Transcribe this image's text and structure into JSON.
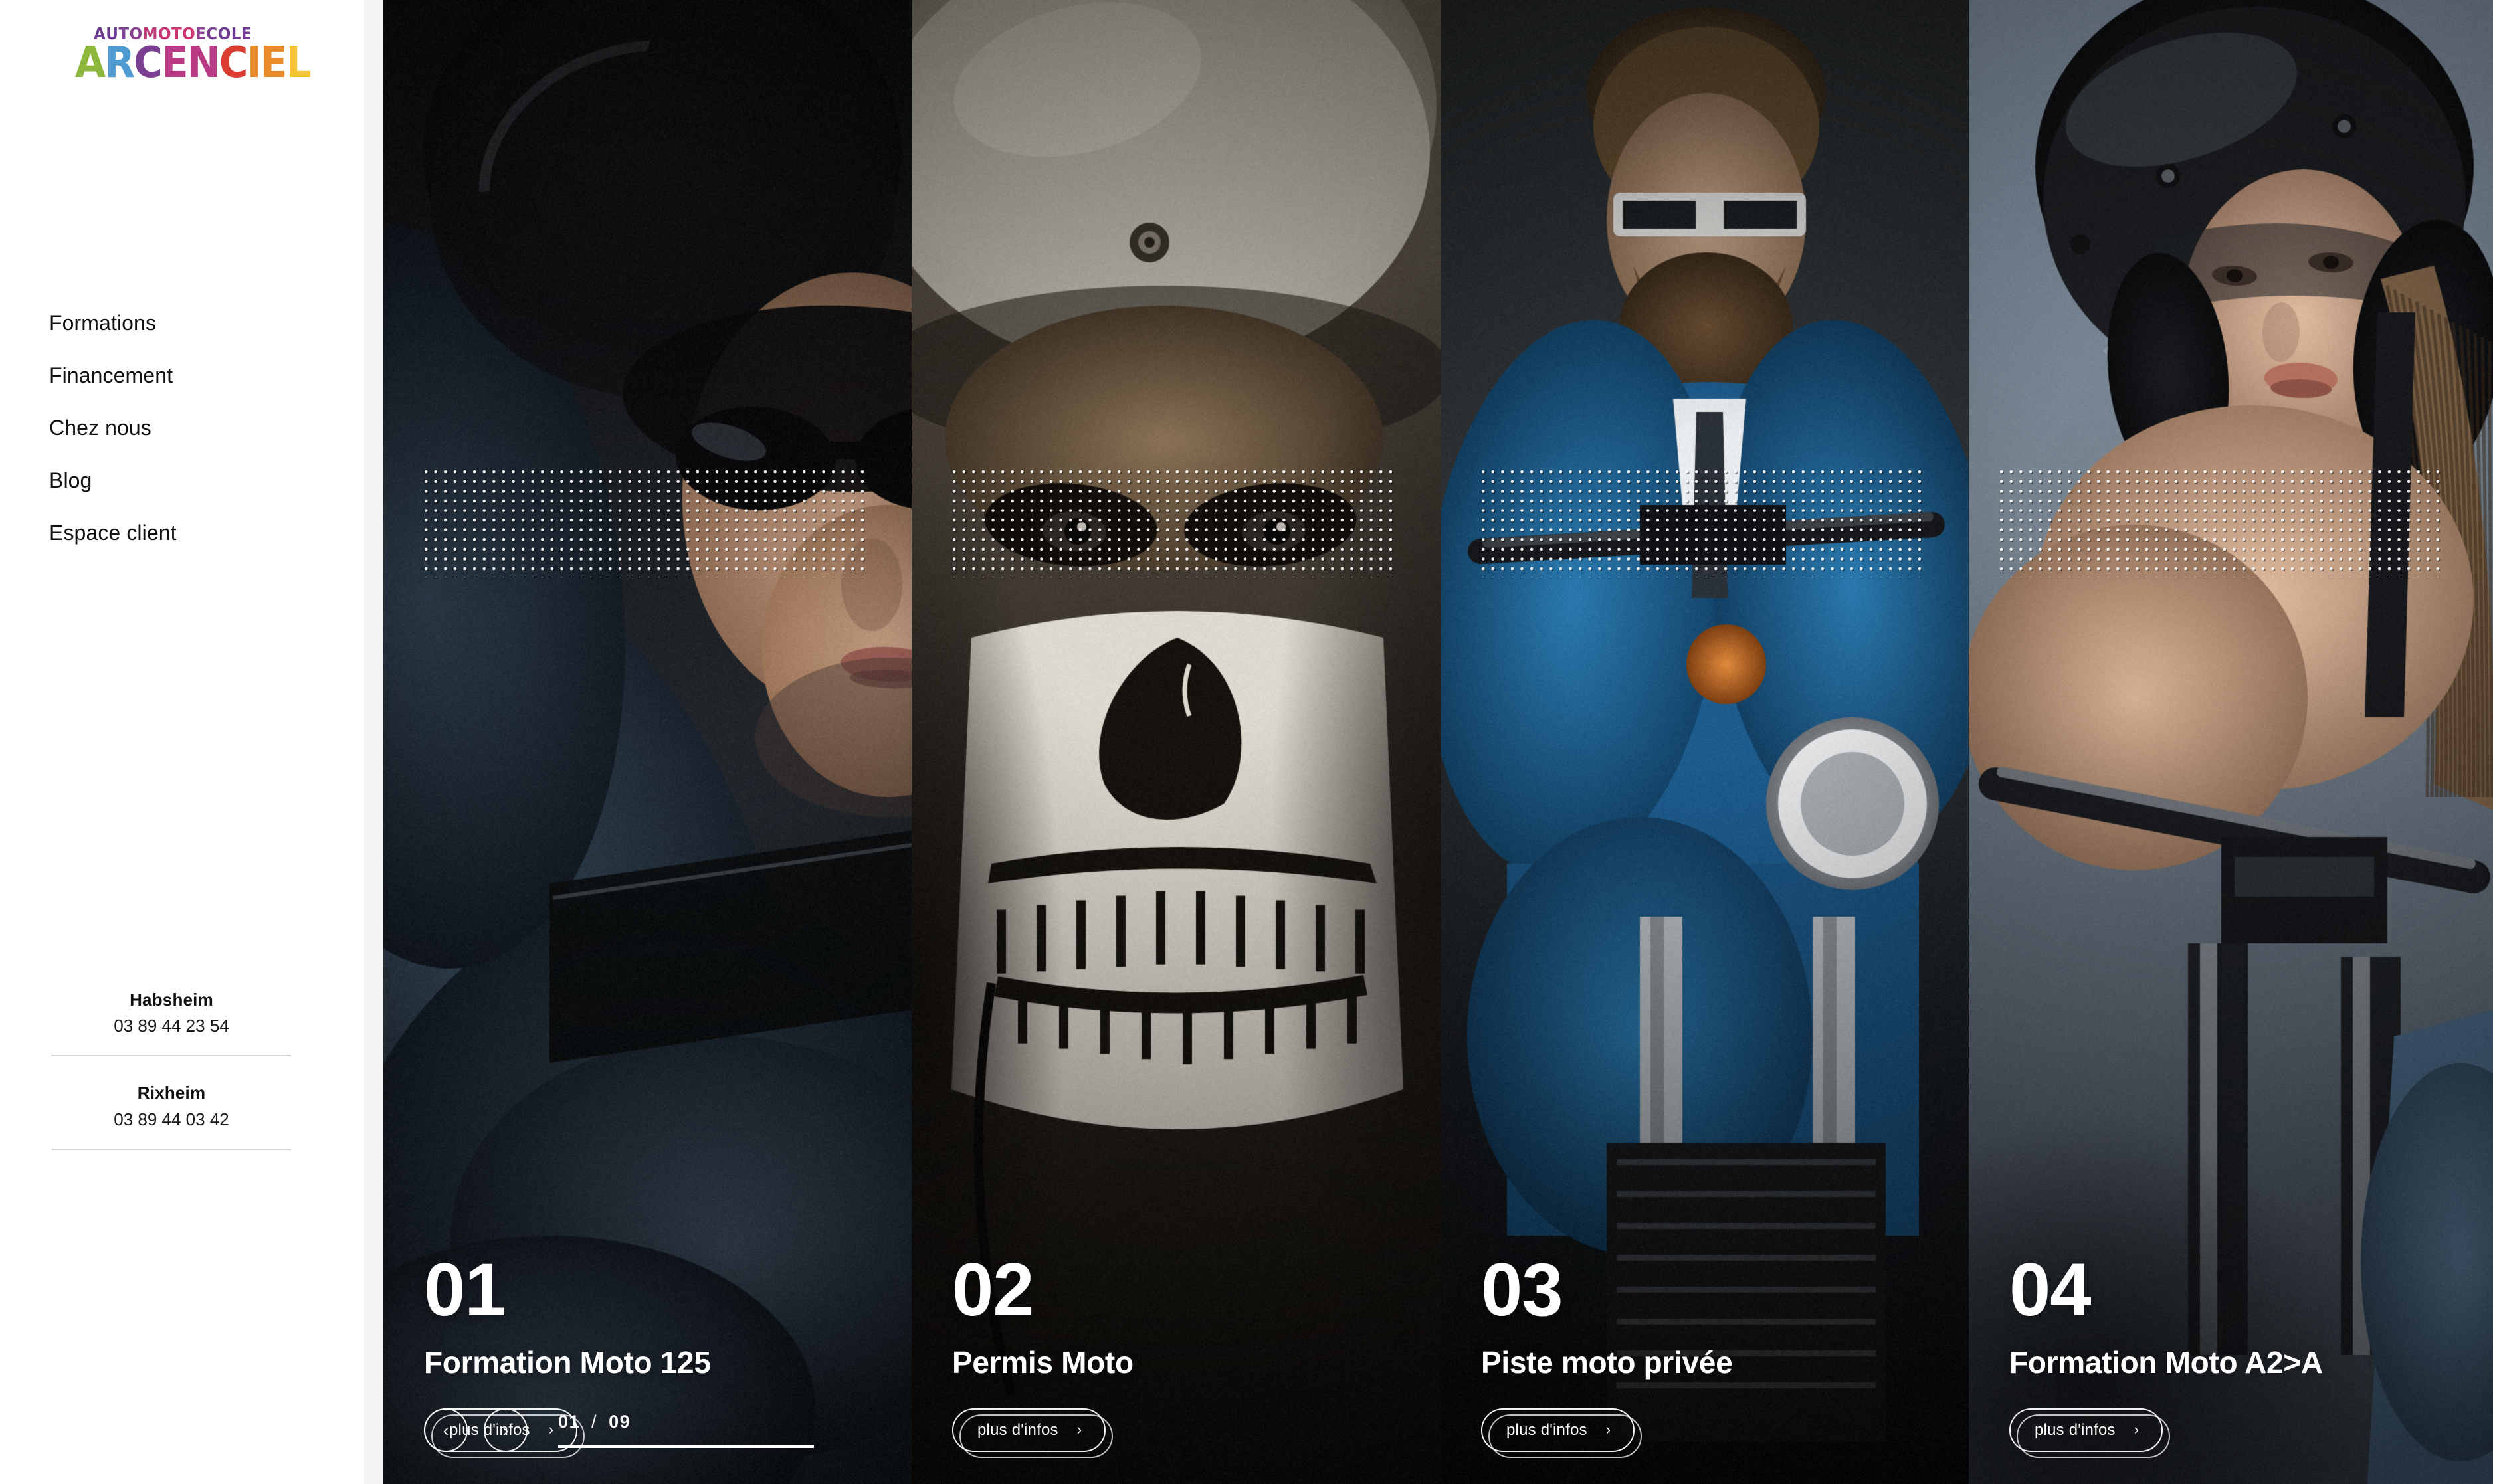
{
  "brand": {
    "logo_top": "AUTOMOTOECOLE",
    "logo_main": "ARCENCIEL",
    "logo_top_letters": [
      {
        "c": "A",
        "color": "#6d3b8f"
      },
      {
        "c": "U",
        "color": "#6d3b8f"
      },
      {
        "c": "T",
        "color": "#7b3f92"
      },
      {
        "c": "O",
        "color": "#8a3f90"
      },
      {
        "c": "M",
        "color": "#c23b7c"
      },
      {
        "c": "O",
        "color": "#c9377a"
      },
      {
        "c": "T",
        "color": "#cf3572"
      },
      {
        "c": "O",
        "color": "#cf3572"
      },
      {
        "c": "E",
        "color": "#8a3f90"
      },
      {
        "c": "C",
        "color": "#7b3f92"
      },
      {
        "c": "O",
        "color": "#6d3b8f"
      },
      {
        "c": "L",
        "color": "#6d3b8f"
      },
      {
        "c": "E",
        "color": "#6d3b8f"
      }
    ],
    "logo_main_letters": [
      {
        "c": "A",
        "color": "#8cb63c"
      },
      {
        "c": "R",
        "color": "#4e9bd1"
      },
      {
        "c": "C",
        "color": "#7b3f92"
      },
      {
        "c": "E",
        "color": "#b83a84"
      },
      {
        "c": "N",
        "color": "#b83a84"
      },
      {
        "c": "C",
        "color": "#d93c30"
      },
      {
        "c": "I",
        "color": "#e98a2b"
      },
      {
        "c": "E",
        "color": "#e98a2b"
      },
      {
        "c": "L",
        "color": "#f2c42f"
      }
    ]
  },
  "nav": {
    "items": [
      {
        "label": "Formations"
      },
      {
        "label": "Financement"
      },
      {
        "label": "Chez nous"
      },
      {
        "label": "Blog"
      },
      {
        "label": "Espace client"
      }
    ]
  },
  "contacts": [
    {
      "city": "Habsheim",
      "phone": "03 89 44 23 54"
    },
    {
      "city": "Rixheim",
      "phone": "03 89 44 03 42"
    }
  ],
  "slider": {
    "slides": [
      {
        "number": "01",
        "title": "Formation Moto 125",
        "cta": "plus d'infos",
        "chevron": "›"
      },
      {
        "number": "02",
        "title": "Permis Moto",
        "cta": "plus d'infos",
        "chevron": "›"
      },
      {
        "number": "03",
        "title": "Piste moto privée",
        "cta": "plus d'infos",
        "chevron": "›"
      },
      {
        "number": "04",
        "title": "Formation Moto A2>A",
        "cta": "plus d'infos",
        "chevron": "›"
      }
    ],
    "controls": {
      "prev_glyph": "‹",
      "next_glyph": "›",
      "current": "01",
      "separator": "/",
      "total": "09",
      "progress_percent": 100
    }
  },
  "colors": {
    "sidebar_bg": "#ffffff",
    "gutter_bg": "#f4f4f4",
    "text": "#111111",
    "slide_text": "#ffffff",
    "divider": "#d2d2d2"
  }
}
